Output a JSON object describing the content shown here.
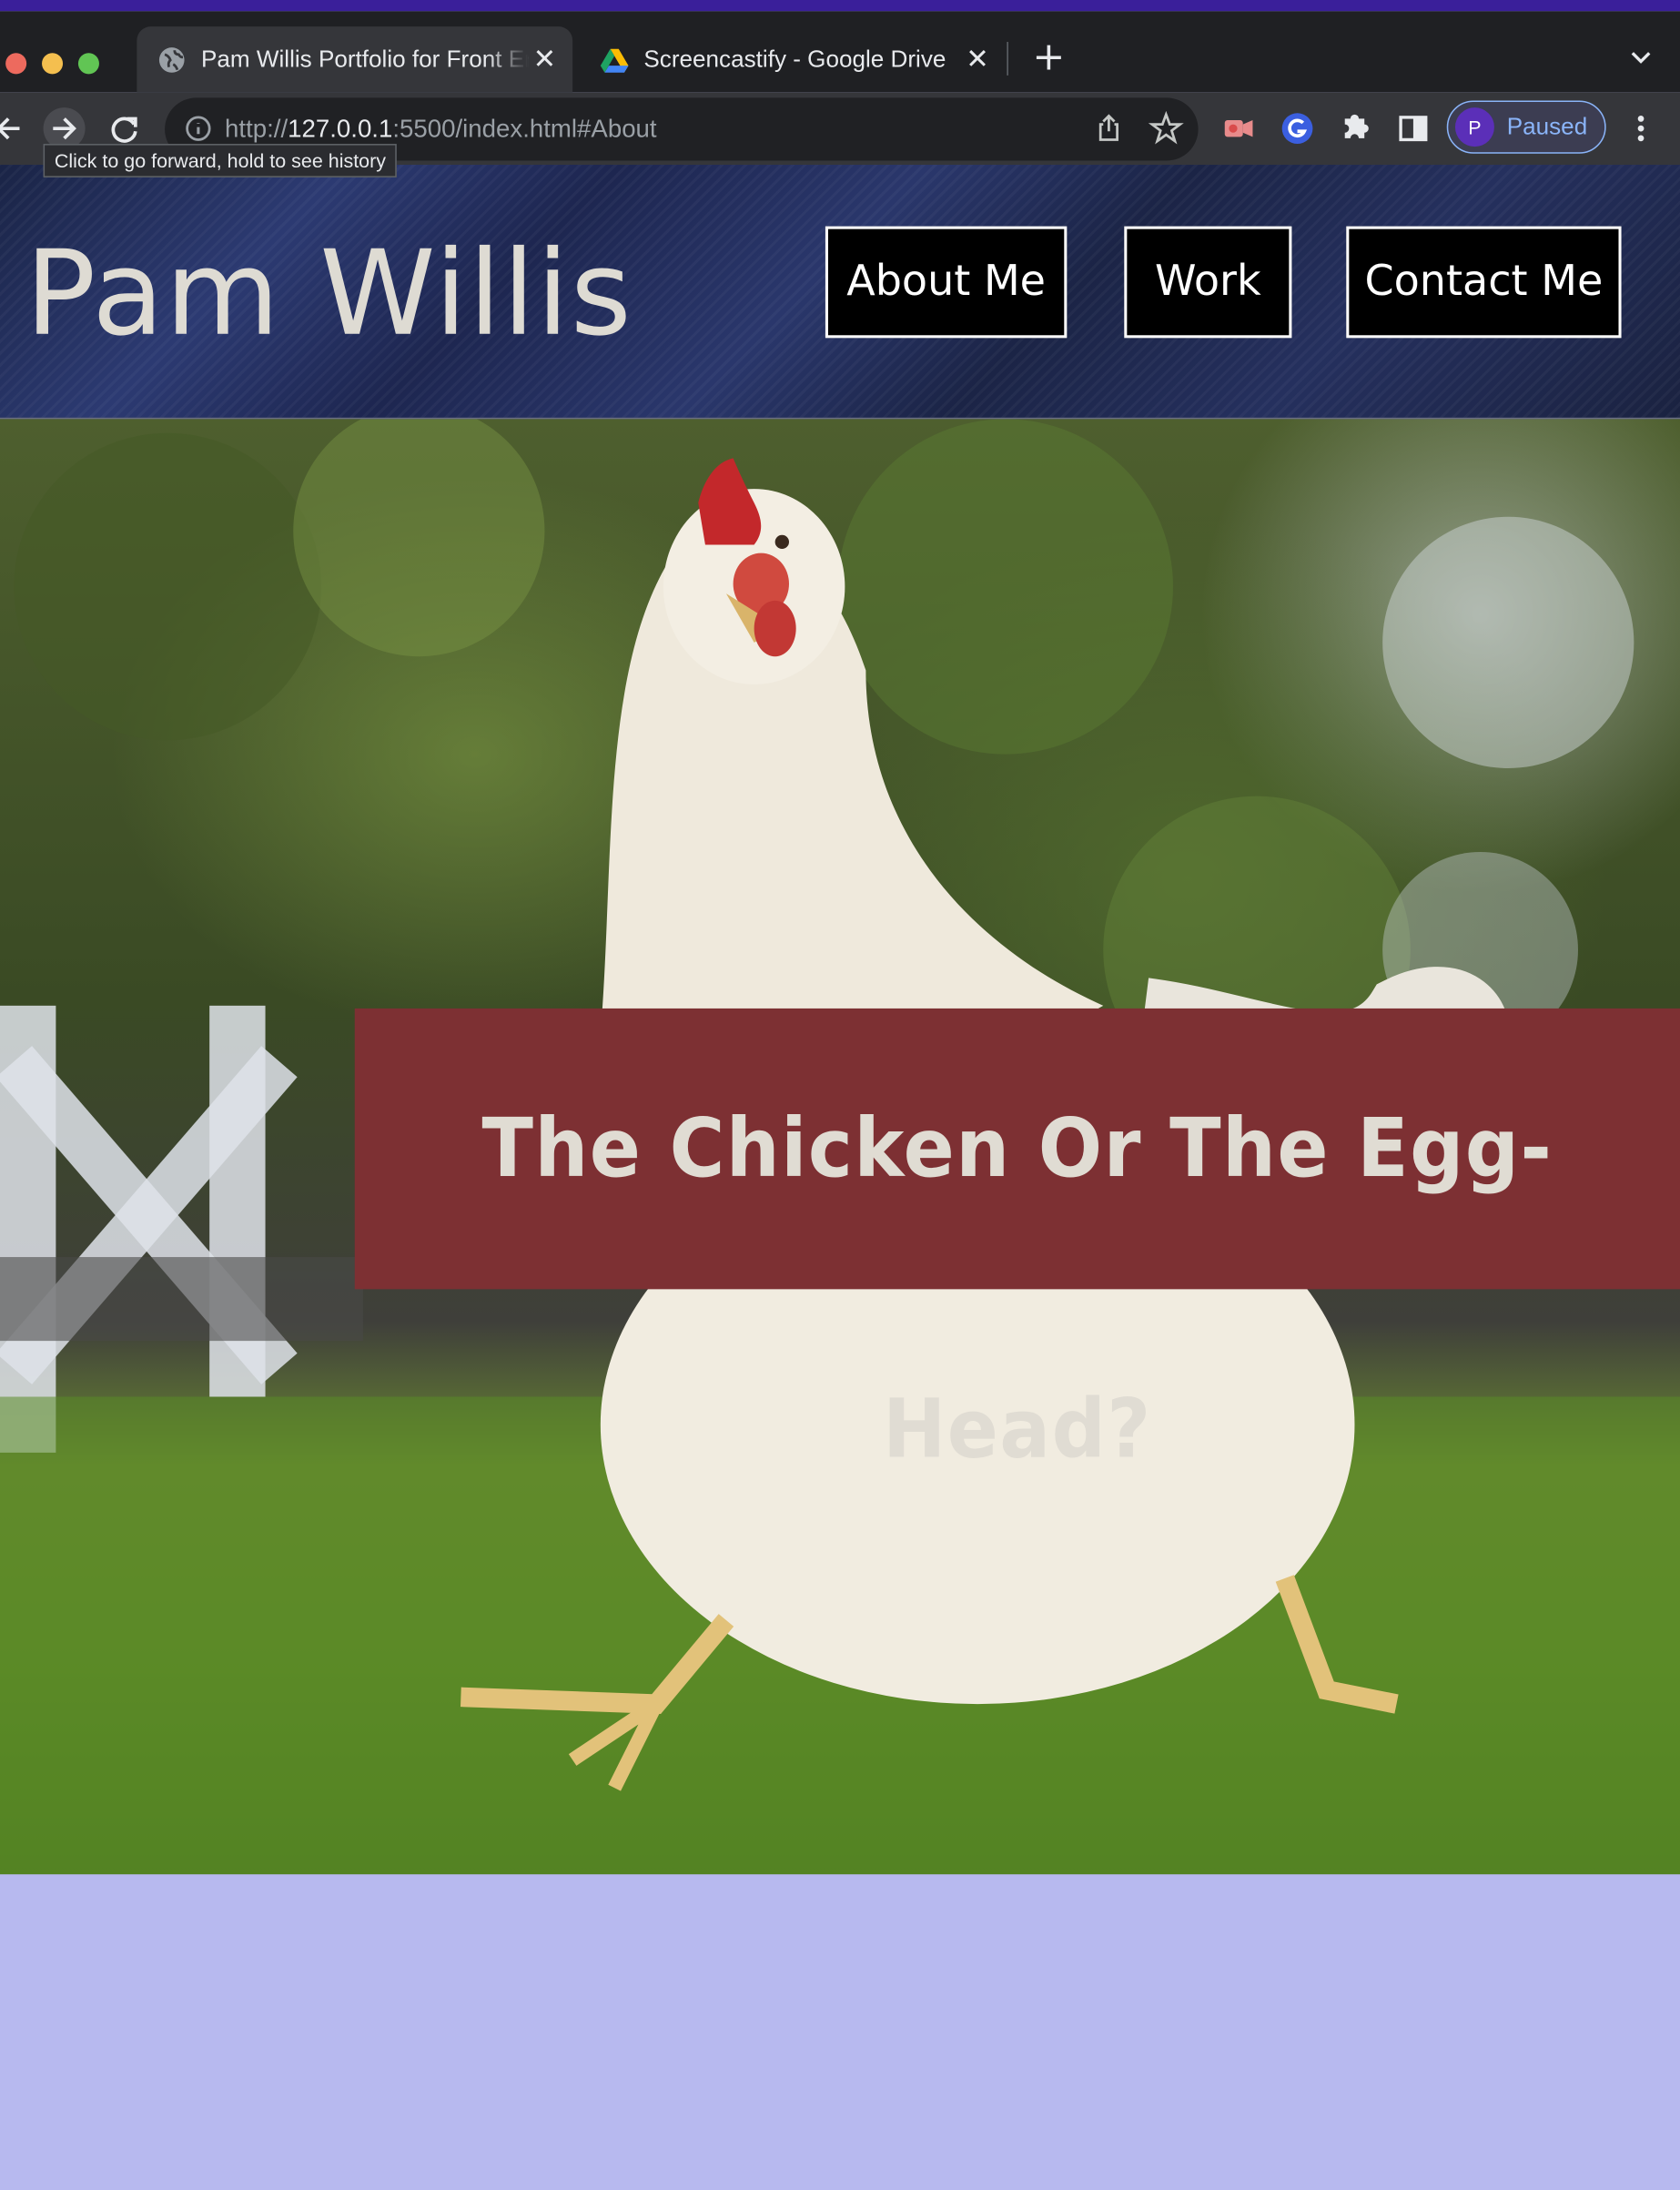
{
  "browser": {
    "tabs": [
      {
        "title": "Pam Willis Portfolio for Front End Developer",
        "active": true
      },
      {
        "title": "Screencastify - Google Drive",
        "active": false
      }
    ],
    "url": {
      "scheme": "http://",
      "host": "127.0.0.1",
      "rest": ":5500/index.html#About"
    },
    "tooltip": "Click to go forward, hold to see history",
    "profile": {
      "initial": "P",
      "status": "Paused"
    }
  },
  "site": {
    "title": "Pam Willis",
    "nav": [
      {
        "label": "About Me"
      },
      {
        "label": "Work"
      },
      {
        "label": "Contact Me"
      }
    ],
    "hero": {
      "banner_text": "The Chicken Or The Egg-Head?"
    }
  },
  "colors": {
    "banner": "#7d3033",
    "page_background": "#b7b9ef",
    "header_background": "#1c2540",
    "nav_button": "#000000"
  },
  "icons": [
    "back-icon",
    "forward-icon",
    "reload-icon",
    "info-icon",
    "share-icon",
    "bookmark-star-icon",
    "screencastify-icon",
    "grammarly-icon",
    "extensions-icon",
    "side-panel-icon",
    "menu-icon",
    "globe-icon",
    "drive-icon",
    "tab-list-icon"
  ]
}
